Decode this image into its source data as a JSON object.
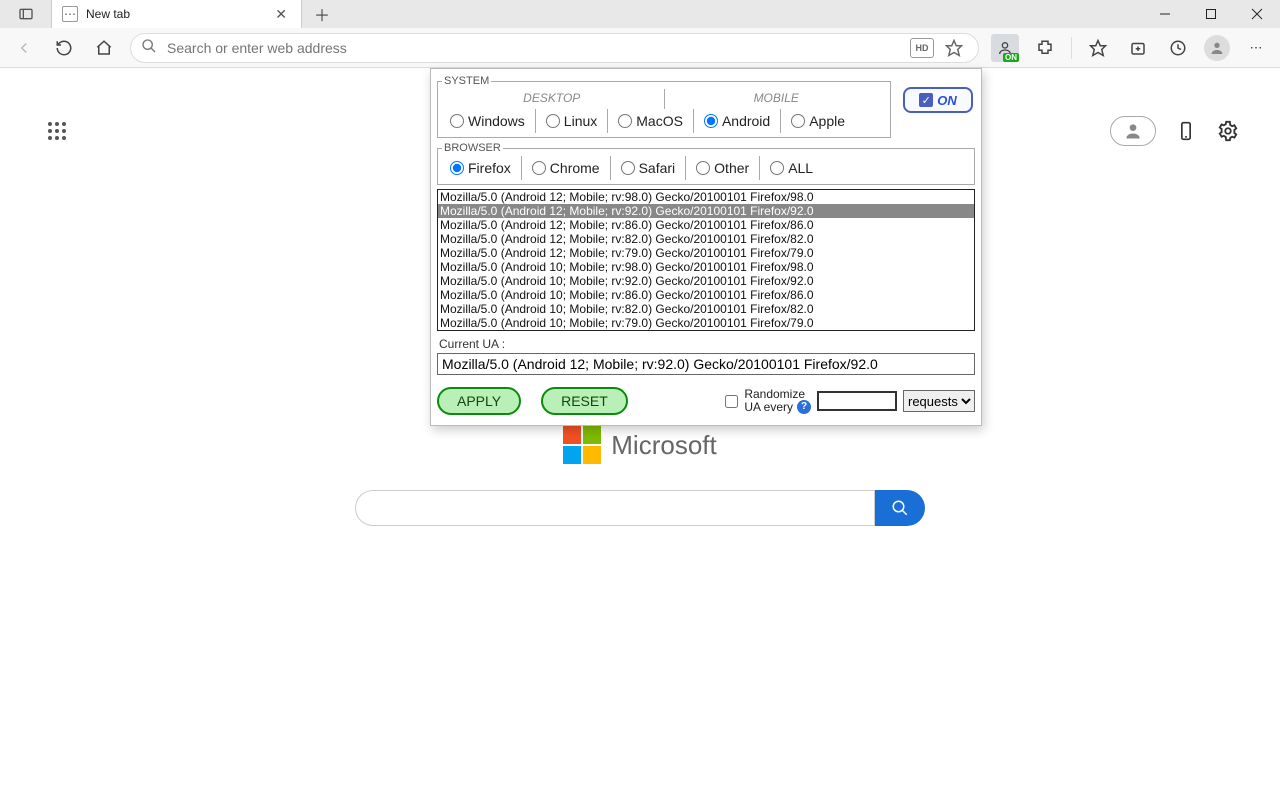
{
  "tab": {
    "title": "New tab"
  },
  "addressbar": {
    "placeholder": "Search or enter web address",
    "hd": "HD"
  },
  "ext_badge": "ON",
  "newtab": {
    "brand": "Microsoft"
  },
  "popup": {
    "system": {
      "legend": "SYSTEM",
      "groups": {
        "desktop": "DESKTOP",
        "mobile": "MOBILE"
      },
      "options": {
        "windows": "Windows",
        "linux": "Linux",
        "macos": "MacOS",
        "android": "Android",
        "apple": "Apple"
      },
      "selected": "android"
    },
    "browser": {
      "legend": "BROWSER",
      "options": {
        "firefox": "Firefox",
        "chrome": "Chrome",
        "safari": "Safari",
        "other": "Other",
        "all": "ALL"
      },
      "selected": "firefox"
    },
    "toggle": {
      "label": "ON",
      "checked": true
    },
    "ua_list": [
      "Mozilla/5.0 (Android 12; Mobile; rv:98.0) Gecko/20100101 Firefox/98.0",
      "Mozilla/5.0 (Android 12; Mobile; rv:92.0) Gecko/20100101 Firefox/92.0",
      "Mozilla/5.0 (Android 12; Mobile; rv:86.0) Gecko/20100101 Firefox/86.0",
      "Mozilla/5.0 (Android 12; Mobile; rv:82.0) Gecko/20100101 Firefox/82.0",
      "Mozilla/5.0 (Android 12; Mobile; rv:79.0) Gecko/20100101 Firefox/79.0",
      "Mozilla/5.0 (Android 10; Mobile; rv:98.0) Gecko/20100101 Firefox/98.0",
      "Mozilla/5.0 (Android 10; Mobile; rv:92.0) Gecko/20100101 Firefox/92.0",
      "Mozilla/5.0 (Android 10; Mobile; rv:86.0) Gecko/20100101 Firefox/86.0",
      "Mozilla/5.0 (Android 10; Mobile; rv:82.0) Gecko/20100101 Firefox/82.0",
      "Mozilla/5.0 (Android 10; Mobile; rv:79.0) Gecko/20100101 Firefox/79.0"
    ],
    "ua_selected_index": 1,
    "current_ua_label": "Current UA :",
    "current_ua": "Mozilla/5.0 (Android 12; Mobile; rv:92.0) Gecko/20100101 Firefox/92.0",
    "buttons": {
      "apply": "APPLY",
      "reset": "RESET"
    },
    "randomize": {
      "line1": "Randomize",
      "line2": "UA every",
      "unit_options": [
        "requests"
      ],
      "unit_selected": "requests"
    }
  }
}
